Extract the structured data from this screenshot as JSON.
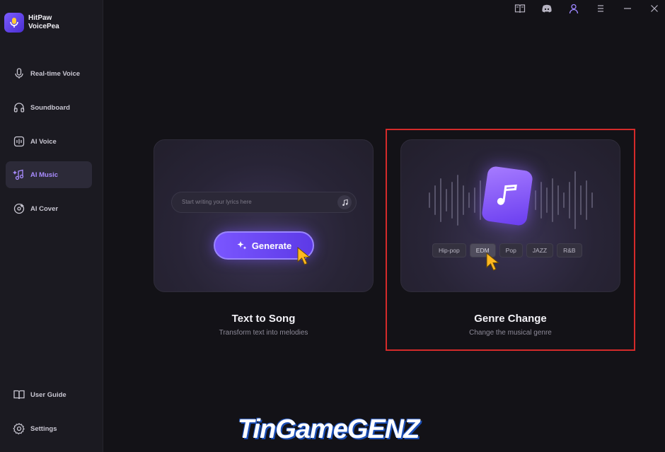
{
  "brand": {
    "line1": "HitPaw",
    "line2": "VoicePea"
  },
  "sidebar": {
    "items": [
      {
        "label": "Real-time Voice",
        "icon": "microphone-icon"
      },
      {
        "label": "Soundboard",
        "icon": "headphones-icon"
      },
      {
        "label": "AI Voice",
        "icon": "ai-voice-icon"
      },
      {
        "label": "AI Music",
        "icon": "music-sparkle-icon",
        "active": true
      },
      {
        "label": "AI Cover",
        "icon": "vinyl-icon"
      }
    ],
    "bottom": [
      {
        "label": "User Guide",
        "icon": "book-icon"
      },
      {
        "label": "Settings",
        "icon": "gear-icon"
      }
    ]
  },
  "topbar": {
    "icons": [
      "guide-book-icon",
      "discord-icon",
      "user-icon",
      "menu-icon",
      "minimize-icon",
      "close-icon"
    ]
  },
  "cards": {
    "text_to_song": {
      "placeholder": "Start writing your lyrics here",
      "button": "Generate",
      "title": "Text to Song",
      "subtitle": "Transform text into melodies"
    },
    "genre_change": {
      "genres": [
        "Hip-pop",
        "EDM",
        "Pop",
        "JAZZ",
        "R&B"
      ],
      "selected": "EDM",
      "title": "Genre Change",
      "subtitle": "Change the musical genre"
    }
  },
  "watermark": "TinGameGENZ",
  "colors": {
    "accent": "#7a56ff",
    "highlight": "#d42a2a",
    "active_nav_text": "#a98cff"
  }
}
